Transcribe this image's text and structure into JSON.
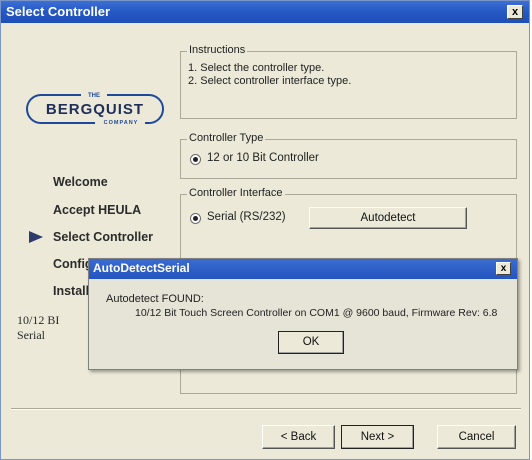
{
  "window": {
    "title": "Select Controller",
    "close_glyph": "x"
  },
  "logo": {
    "the": "THE",
    "name": "BERGQUIST",
    "company": "COMPANY"
  },
  "sidebar": {
    "items": [
      {
        "label": "Welcome"
      },
      {
        "label": "Accept HEULA"
      },
      {
        "label": "Select Controller",
        "current": true
      },
      {
        "label": "Config"
      },
      {
        "label": "Install"
      }
    ],
    "status_line1": "10/12 BI",
    "status_line2": "Serial",
    "current_icon": "arrow-right-icon"
  },
  "instructions": {
    "title": "Instructions",
    "line1": "1. Select the controller type.",
    "line2": "2. Select controller interface type."
  },
  "controller_type": {
    "title": "Controller Type",
    "option_label": "12 or 10 Bit Controller",
    "selected": true
  },
  "controller_interface": {
    "title": "Controller Interface",
    "option_label": "Serial (RS/232)",
    "selected": true,
    "autodetect_label": "Autodetect"
  },
  "footer": {
    "back_label": "< Back",
    "next_label": "Next >",
    "cancel_label": "Cancel"
  },
  "dialog": {
    "title": "AutoDetectSerial",
    "close_glyph": "x",
    "line1": "Autodetect FOUND:",
    "line2": "10/12 Bit Touch Screen Controller on COM1 @ 9600 baud, Firmware Rev: 6.8",
    "ok_label": "OK"
  },
  "colors": {
    "titlebar": "#2458c4",
    "window_bg": "#ece9d8",
    "logo_blue": "#1f4a9b"
  }
}
